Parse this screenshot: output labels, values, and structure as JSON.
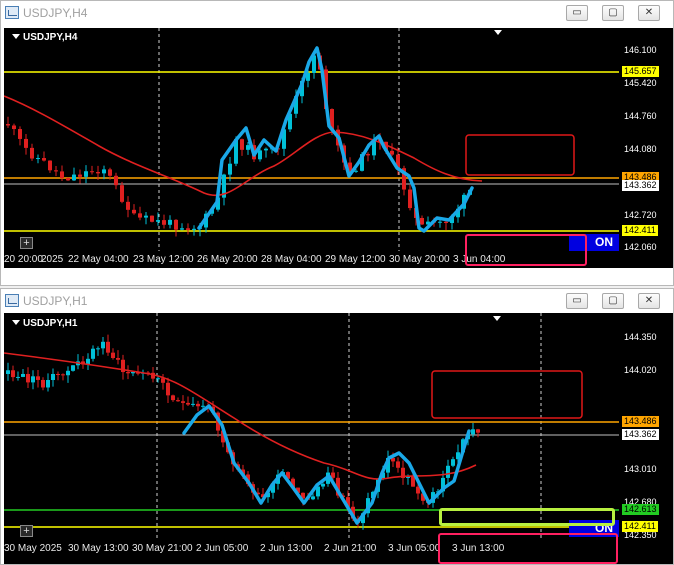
{
  "windows": [
    {
      "title": "USDJPY,H4",
      "symbol": "USDJPY,H4",
      "controls": {
        "min": "▭",
        "max": "▢",
        "close": "✕"
      },
      "price_scale": [
        "146.100",
        "145.420",
        "144.760",
        "144.080",
        "143.362",
        "142.720",
        "142.060"
      ],
      "levels": [
        {
          "label": "145.657",
          "color": "#ffff00"
        },
        {
          "label": "143.486",
          "color": "#ffa500"
        },
        {
          "label": "142.411",
          "color": "#ffff00"
        }
      ],
      "current_price": "143.362",
      "time_labels": [
        "20 20:00",
        "2025",
        "22 May 04:00",
        "23 May 12:00",
        "26 May 20:00",
        "28 May 04:00",
        "29 May 12:00",
        "30 May 20:00",
        "3 Jun 04:00"
      ],
      "on_button": "ON",
      "plus_button": "+"
    },
    {
      "title": "USDJPY,H1",
      "symbol": "USDJPY,H1",
      "controls": {
        "min": "▭",
        "max": "▢",
        "close": "✕"
      },
      "price_scale": [
        "144.350",
        "144.020",
        "143.362",
        "143.010",
        "142.680",
        "142.350"
      ],
      "levels": [
        {
          "label": "143.486",
          "color": "#ffa500"
        },
        {
          "label": "142.613",
          "color": "#22cc22"
        },
        {
          "label": "142.411",
          "color": "#ffff00"
        }
      ],
      "current_price": "143.362",
      "time_labels": [
        "30 May 2025",
        "30 May 13:00",
        "30 May 21:00",
        "2 Jun 05:00",
        "2 Jun 13:00",
        "2 Jun 21:00",
        "3 Jun 05:00",
        "3 Jun 13:00"
      ],
      "on_button": "ON",
      "plus_button": "+"
    }
  ],
  "colors": {
    "background": "#000000",
    "bull": "#00c0d8",
    "bear": "#e02020",
    "ma": "#e02020",
    "trace": "#1aa8e8",
    "annotation": "#ff2060"
  }
}
